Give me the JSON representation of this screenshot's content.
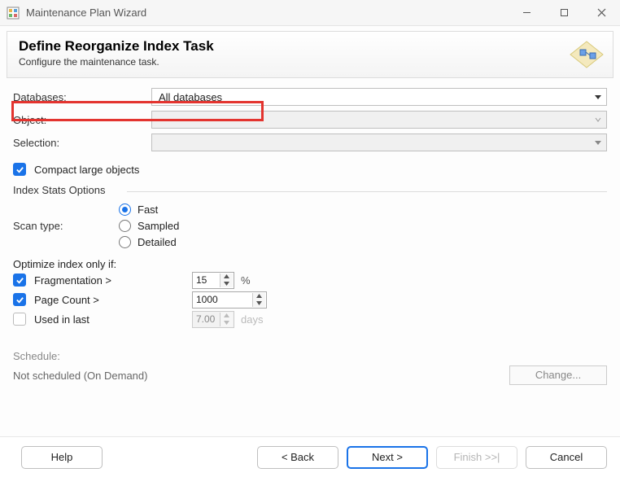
{
  "window": {
    "title": "Maintenance Plan Wizard"
  },
  "header": {
    "title": "Define Reorganize Index Task",
    "subtitle": "Configure the maintenance task."
  },
  "fields": {
    "databases_label": "Databases:",
    "databases_value": "All databases",
    "object_label": "Object:",
    "object_value": "",
    "selection_label": "Selection:",
    "selection_value": ""
  },
  "compact": {
    "label": "Compact large objects",
    "checked": true
  },
  "stats_title": "Index Stats Options",
  "scan": {
    "label": "Scan type:",
    "options": [
      "Fast",
      "Sampled",
      "Detailed"
    ],
    "selected": "Fast"
  },
  "optimize": {
    "title": "Optimize index only if:",
    "frag_label": "Fragmentation >",
    "frag_checked": true,
    "frag_value": "15",
    "frag_unit": "%",
    "page_label": "Page Count >",
    "page_checked": true,
    "page_value": "1000",
    "used_label": "Used  in last",
    "used_checked": false,
    "used_value": "7.00",
    "used_unit": "days"
  },
  "schedule": {
    "label": "Schedule:",
    "value": "Not scheduled (On Demand)",
    "change": "Change..."
  },
  "buttons": {
    "help": "Help",
    "back": "< Back",
    "next": "Next >",
    "finish": "Finish >>|",
    "cancel": "Cancel"
  }
}
